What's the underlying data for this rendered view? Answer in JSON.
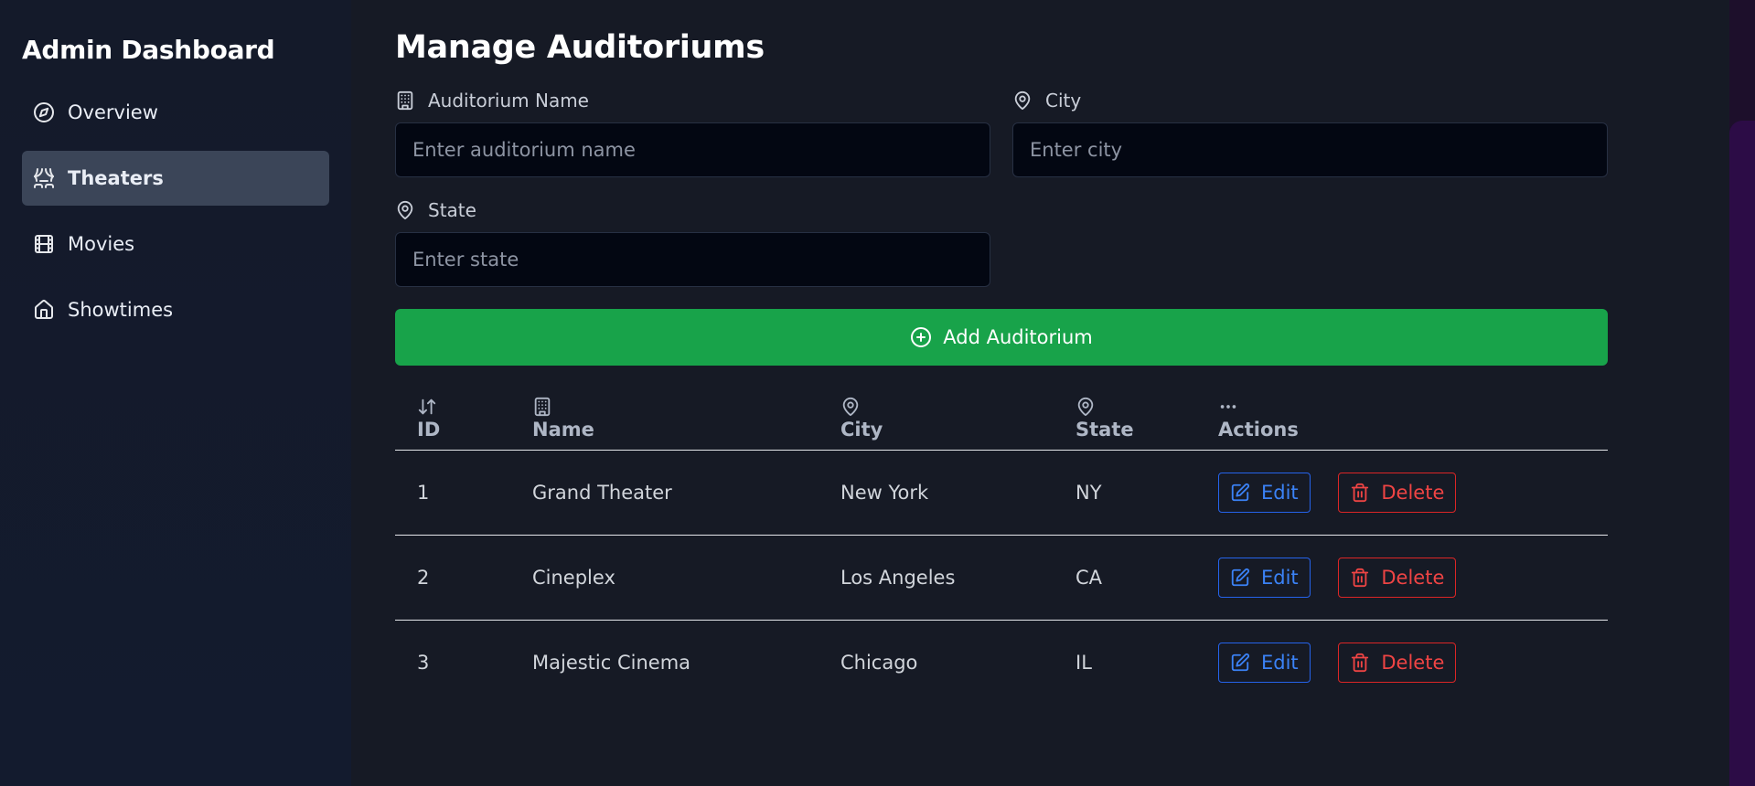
{
  "sidebar": {
    "title": "Admin Dashboard",
    "items": [
      {
        "label": "Overview",
        "icon": "compass-icon",
        "active": false
      },
      {
        "label": "Theaters",
        "icon": "theater-icon",
        "active": true
      },
      {
        "label": "Movies",
        "icon": "film-icon",
        "active": false
      },
      {
        "label": "Showtimes",
        "icon": "home-icon",
        "active": false
      }
    ]
  },
  "main": {
    "title": "Manage Auditoriums",
    "form": {
      "name_label": "Auditorium Name",
      "name_placeholder": "Enter auditorium name",
      "city_label": "City",
      "city_placeholder": "Enter city",
      "state_label": "State",
      "state_placeholder": "Enter state",
      "add_button": "Add Auditorium"
    },
    "table": {
      "headers": [
        "ID",
        "Name",
        "City",
        "State",
        "Actions"
      ],
      "rows": [
        {
          "id": "1",
          "name": "Grand Theater",
          "city": "New York",
          "state": "NY"
        },
        {
          "id": "2",
          "name": "Cineplex",
          "city": "Los Angeles",
          "state": "CA"
        },
        {
          "id": "3",
          "name": "Majestic Cinema",
          "city": "Chicago",
          "state": "IL"
        }
      ],
      "edit_label": "Edit",
      "delete_label": "Delete"
    }
  },
  "colors": {
    "accent_green": "#18a34a",
    "edit_blue": "#3b82f6",
    "delete_red": "#ef4444",
    "active_nav": "#3b4558"
  }
}
